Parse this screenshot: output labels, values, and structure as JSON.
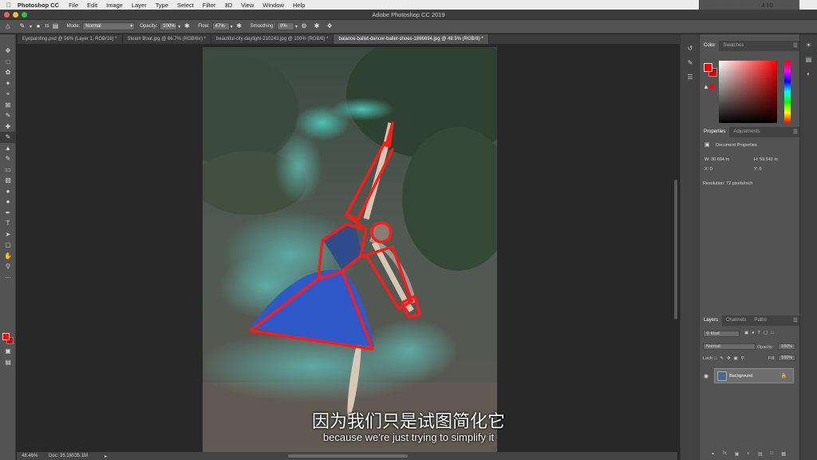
{
  "menubar": {
    "app": "Photoshop CC",
    "items": [
      "File",
      "Edit",
      "Image",
      "Layer",
      "Type",
      "Select",
      "Filter",
      "3D",
      "View",
      "Window",
      "Help"
    ],
    "clock": "Wed 4:10 PM"
  },
  "window": {
    "title": "Adobe Photoshop CC 2019"
  },
  "options": {
    "brush_size": "15",
    "mode_label": "Mode:",
    "mode_value": "Normal",
    "opacity_label": "Opacity:",
    "opacity_value": "100%",
    "flow_label": "Flow:",
    "flow_value": "47%",
    "smoothing_label": "Smoothing:",
    "smoothing_value": "0%"
  },
  "tabs": [
    {
      "label": "Eyepainting.psd @ 56% (Layer 1, RGB/16) *"
    },
    {
      "label": "Steam Boat.jpg @ 66.7% (RGB/8#) *"
    },
    {
      "label": "beautiful-city-daylight-210243.jpg @ 100% (RGB/8) *"
    },
    {
      "label": "balance-ballet-dancer-ballet-shoes-1886694.jpg @ 48.5% (RGB/8) *"
    }
  ],
  "colors": {
    "foreground": "#ff0000",
    "background": "#cc0000",
    "stroke": "#ff1a1a"
  },
  "status": {
    "zoom": "48.46%",
    "doc": "Doc: 35.1M/35.1M"
  },
  "color_panel": {
    "tab_color": "Color",
    "tab_swatches": "Swatches"
  },
  "properties_panel": {
    "tab_properties": "Properties",
    "tab_adjustments": "Adjustments",
    "doc_title": "Document Properties",
    "w": "W: 30.694 in",
    "h": "H: 59.542 in",
    "x": "X: 0",
    "y": "Y: 0",
    "resolution": "Resolution: 72 pixels/inch"
  },
  "layers_panel": {
    "tab_layers": "Layers",
    "tab_channels": "Channels",
    "tab_paths": "Paths",
    "kind": "Kind",
    "blend": "Normal",
    "opacity_label": "Opacity:",
    "opacity_value": "100%",
    "lock_label": "Lock:",
    "fill_label": "Fill:",
    "fill_value": "100%",
    "layer_name": "Background"
  },
  "subtitles": {
    "zh": "因为我们只是试图简化它",
    "en": "because we're just trying to simplify it"
  }
}
